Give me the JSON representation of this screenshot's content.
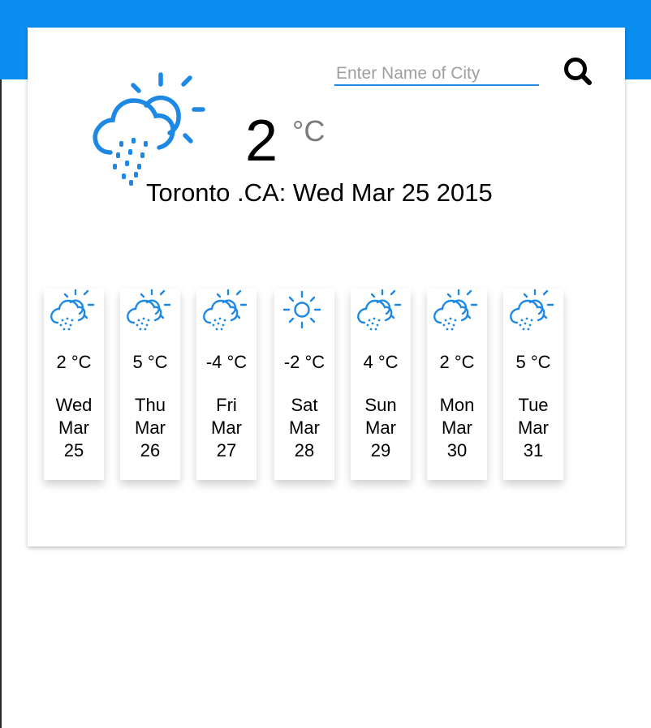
{
  "colors": {
    "top_bar": "#0a8ef0",
    "accent": "#1e88e5",
    "icon": "#1e88e5"
  },
  "search": {
    "placeholder": "Enter Name of City",
    "button_icon": "magnifier-icon"
  },
  "current": {
    "icon": "cloud-sun-rain-icon",
    "temperature": "2",
    "unit": "°C",
    "location": "Toronto .CA: Wed Mar 25 2015"
  },
  "forecast": [
    {
      "icon": "cloud-sun-rain-icon",
      "temp": "2 °C",
      "weekday": "Wed",
      "month": "Mar",
      "day": "25"
    },
    {
      "icon": "cloud-sun-rain-icon",
      "temp": "5 °C",
      "weekday": "Thu",
      "month": "Mar",
      "day": "26"
    },
    {
      "icon": "cloud-sun-rain-icon",
      "temp": "-4 °C",
      "weekday": "Fri",
      "month": "Mar",
      "day": "27"
    },
    {
      "icon": "sun-icon",
      "temp": "-2 °C",
      "weekday": "Sat",
      "month": "Mar",
      "day": "28"
    },
    {
      "icon": "cloud-sun-rain-icon",
      "temp": "4 °C",
      "weekday": "Sun",
      "month": "Mar",
      "day": "29"
    },
    {
      "icon": "cloud-sun-rain-icon",
      "temp": "2 °C",
      "weekday": "Mon",
      "month": "Mar",
      "day": "30"
    },
    {
      "icon": "cloud-sun-rain-icon",
      "temp": "5 °C",
      "weekday": "Tue",
      "month": "Mar",
      "day": "31"
    }
  ]
}
